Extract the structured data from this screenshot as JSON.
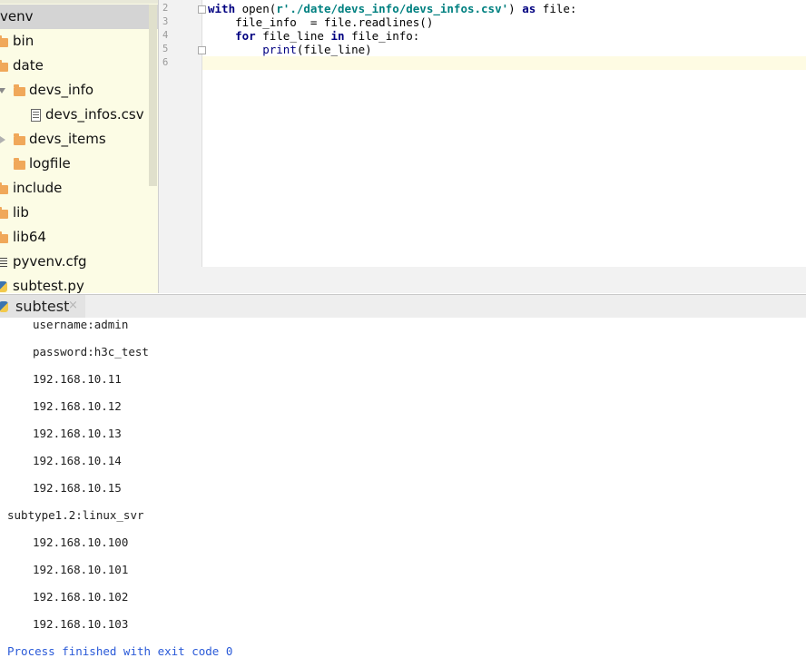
{
  "project_tree": {
    "root_label": "venv",
    "items": [
      {
        "label": "bin",
        "type": "folder"
      },
      {
        "label": "date",
        "type": "folder"
      },
      {
        "label": "devs_info",
        "type": "folder",
        "expanded": true
      },
      {
        "label": "devs_infos.csv",
        "type": "file"
      },
      {
        "label": "devs_items",
        "type": "folder",
        "expanded": false
      },
      {
        "label": "logfile",
        "type": "folder"
      },
      {
        "label": "include",
        "type": "folder"
      },
      {
        "label": "lib",
        "type": "folder"
      },
      {
        "label": "lib64",
        "type": "folder"
      },
      {
        "label": "pyvenv.cfg",
        "type": "config"
      },
      {
        "label": "subtest.py",
        "type": "python"
      }
    ]
  },
  "editor": {
    "line_numbers": [
      "2",
      "3",
      "4",
      "5",
      "6"
    ],
    "lines": [
      {
        "kw_with": "with",
        "fn_open": " open(",
        "str_path": "r'./date/devs_info/devs_infos.csv'",
        "close": ") ",
        "kw_as": "as",
        "rest": " file:"
      },
      {
        "text": "    file_info  = file.readlines()"
      },
      {
        "indent": "    ",
        "kw_for": "for",
        "mid": " file_line ",
        "kw_in": "in",
        "rest": " file_info:"
      },
      {
        "indent": "        ",
        "bi_print": "print",
        "rest": "(file_line)"
      },
      {
        "text": ""
      }
    ]
  },
  "run_panel": {
    "tab_label": "subtest",
    "close_icon": "×"
  },
  "console": {
    "lines": [
      "username:admin",
      "password:h3c_test",
      "192.168.10.11",
      "192.168.10.12",
      "192.168.10.13",
      "192.168.10.14",
      "192.168.10.15",
      "subtype1.2:linux_svr",
      "192.168.10.100",
      "192.168.10.101",
      "192.168.10.102",
      "192.168.10.103"
    ],
    "exit_message": "Process finished with exit code 0"
  },
  "colors": {
    "tree_bg": "#fcfce5",
    "folder": "#f0a85a",
    "keyword": "#000080",
    "string": "#008080",
    "exit_text": "#2a5ad8"
  }
}
